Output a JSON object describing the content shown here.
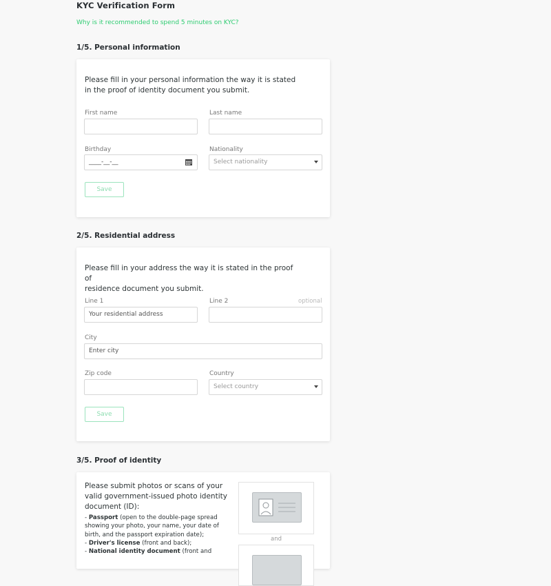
{
  "page": {
    "title": "KYC Verification Form",
    "help_link": "Why is it recommended to spend 5 minutes on KYC?"
  },
  "colors": {
    "accent": "#2ecc71",
    "button_border": "#9be3bd",
    "background": "#f8f8f8",
    "card": "#ffffff"
  },
  "personal": {
    "title": "1/5. Personal information",
    "intro_line1": "Please fill in your personal information the way it is stated",
    "intro_line2": "in the proof of identity document you submit.",
    "first_name_label": "First name",
    "first_name_value": "",
    "last_name_label": "Last name",
    "last_name_value": "",
    "birthday_label": "Birthday",
    "birthday_value": "____-__-__",
    "nationality_label": "Nationality",
    "nationality_value": "Select nationality",
    "save_label": "Save"
  },
  "address": {
    "title": "2/5. Residential address",
    "intro_line1": "Please fill in your address the way it is stated in the proof of",
    "intro_line2": "residence document you submit.",
    "line1_label": "Line 1",
    "line1_placeholder": "Your residential address",
    "line2_label": "Line 2",
    "line2_optional": "optional",
    "line2_value": "",
    "city_label": "City",
    "city_placeholder": "Enter city",
    "zip_label": "Zip code",
    "zip_value": "",
    "country_label": "Country",
    "country_value": "Select country",
    "save_label": "Save"
  },
  "identity": {
    "title": "3/5. Proof of identity",
    "intro_line1": "Please submit photos or scans of your",
    "intro_line2": "valid government-issued photo identity",
    "intro_line3": "document (ID):",
    "doc1_name": "Passport",
    "doc1_desc": " (open to the double-page spread showing your photo, your name, your date of birth, and the passport expiration date);",
    "doc2_name": "Driver's license",
    "doc2_desc": " (front and back);",
    "doc3_name": "National identity document",
    "doc3_desc": " (front and",
    "and_label": "and",
    "front_icon": "id-card-front-icon",
    "back_icon": "id-card-back-icon"
  }
}
